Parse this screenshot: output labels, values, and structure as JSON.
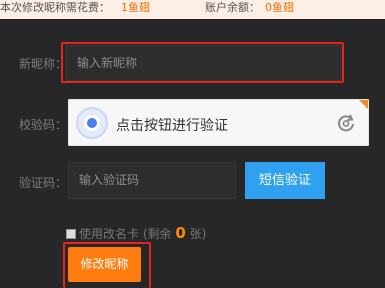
{
  "topbar": {
    "fee_label": "本次修改昵称需花费：",
    "fee_value": "1鱼翅",
    "balance_label": "账户余额：",
    "balance_value": "0鱼翅"
  },
  "form": {
    "nickname_label": "新昵称：",
    "nickname_placeholder": "输入新昵称",
    "captcha_label": "校验码：",
    "captcha_text": "点击按钮进行验证",
    "code_label": "验证码：",
    "code_placeholder": "输入验证码",
    "sms_button": "短信验证",
    "rename_card_text": "使用改名卡 (剩余",
    "rename_card_count": "0",
    "rename_card_unit": "张)",
    "submit_label": "修改昵称"
  },
  "colors": {
    "accent_orange": "#ff7d10",
    "sms_blue": "#2fa1f0",
    "highlight_red": "#e8221e"
  }
}
